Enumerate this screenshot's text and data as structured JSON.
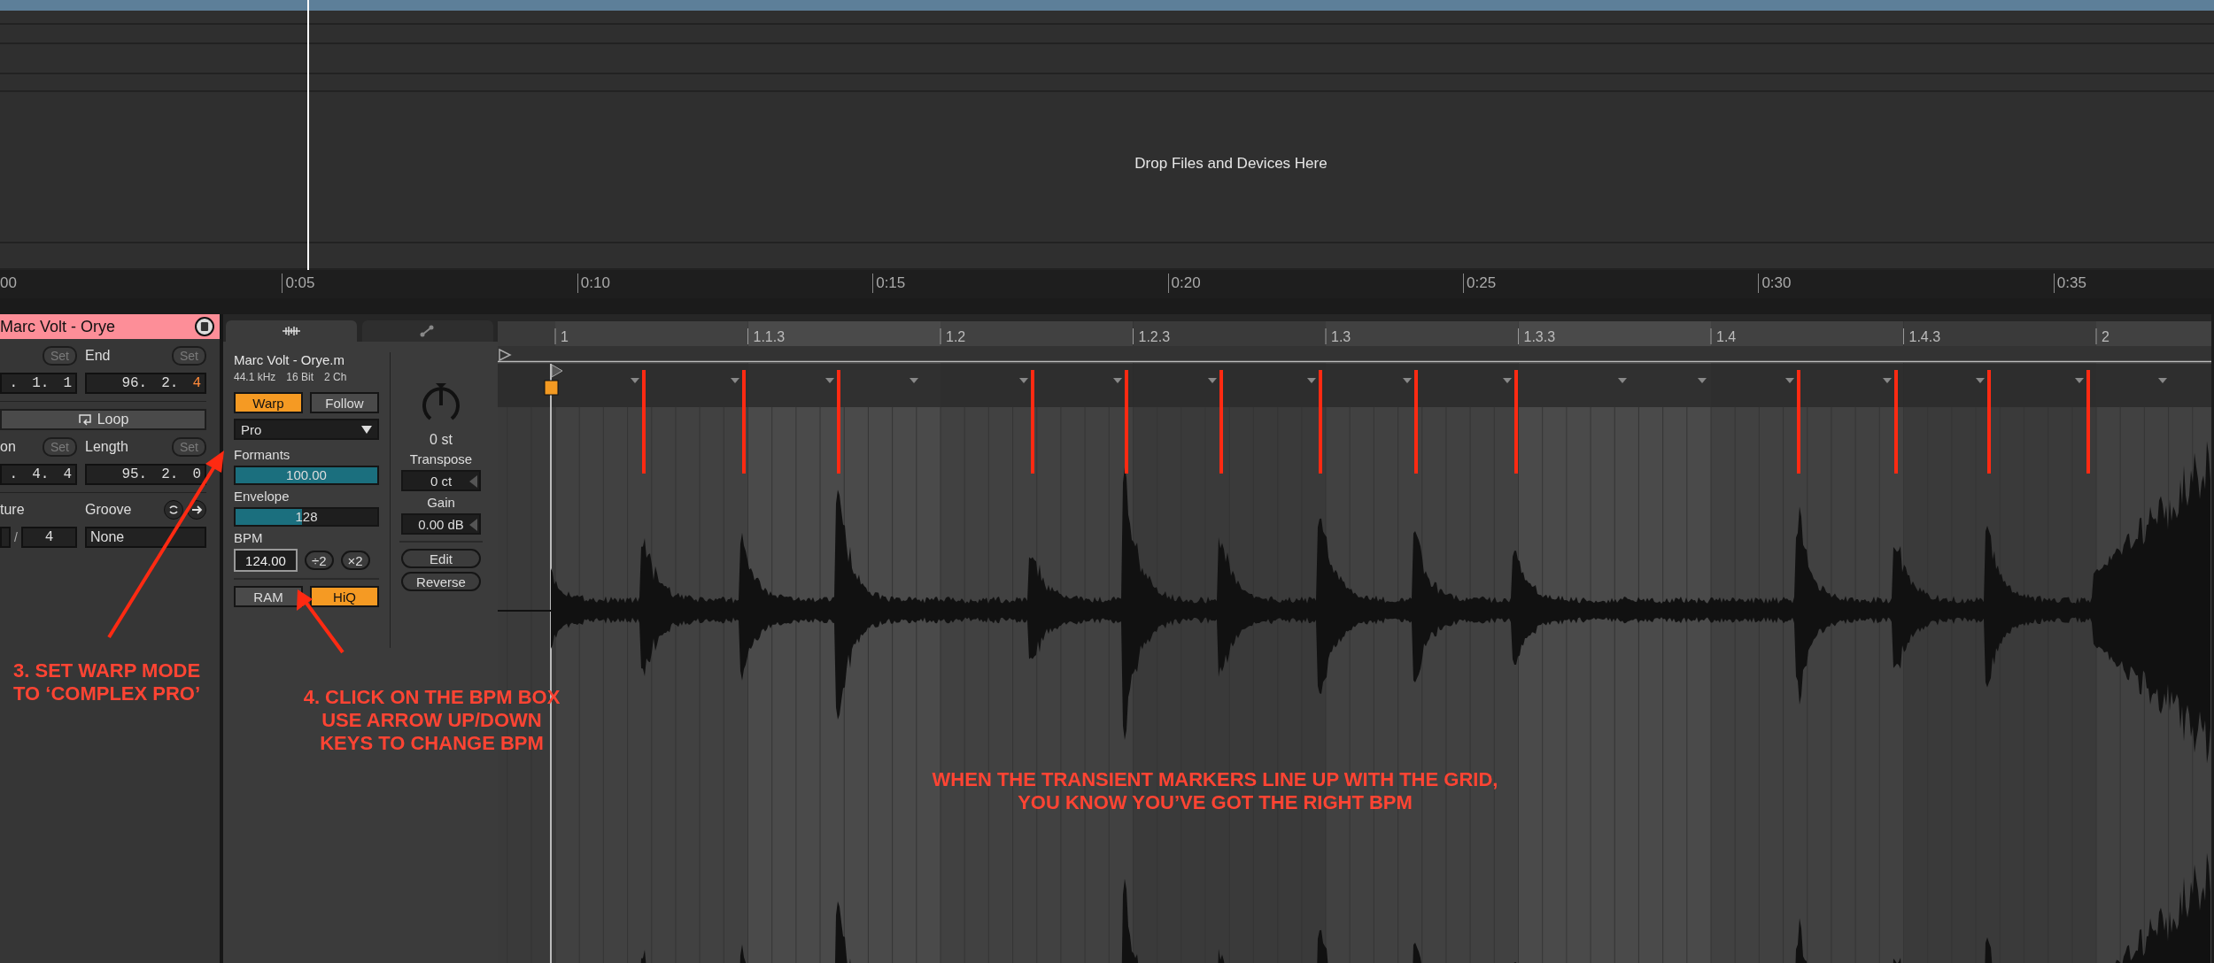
{
  "arrangement": {
    "drop_hint": "Drop Files and Devices Here",
    "time_ruler": [
      "00",
      "0:05",
      "0:10",
      "0:15",
      "0:20",
      "0:25",
      "0:30",
      "0:35"
    ]
  },
  "clip_panel": {
    "title": "Marc Volt - Orye",
    "start": {
      "set_button": {
        "label": "Set",
        "disabled": true
      },
      "value": {
        "parts": [
          ".",
          "1."
        ],
        "last": "1",
        "last_highlighted": false
      }
    },
    "end": {
      "label": "End",
      "set_button": {
        "label": "Set",
        "disabled": true
      },
      "value": {
        "parts": [
          "96.",
          "2."
        ],
        "last": "4",
        "last_highlighted": true
      }
    },
    "loop_button": {
      "label": "Loop",
      "on": false
    },
    "position": {
      "label": "on",
      "set_button": {
        "label": "Set",
        "disabled": true
      },
      "value": {
        "parts": [
          ".",
          "4."
        ],
        "last": "4",
        "last_highlighted": false
      }
    },
    "length": {
      "label": "Length",
      "set_button": {
        "label": "Set",
        "disabled": true
      },
      "value": {
        "parts": [
          "95.",
          "2."
        ],
        "last": "0",
        "last_highlighted": false
      }
    },
    "signature": {
      "label": "ture",
      "separator": "/",
      "denominator": "4"
    },
    "groove": {
      "label": "Groove",
      "value": "None"
    }
  },
  "sample_panel": {
    "tabs": [
      {
        "kind": "sample",
        "selected": true
      },
      {
        "kind": "envelope",
        "selected": false
      }
    ],
    "file_name": "Marc Volt - Orye.m",
    "info": [
      "44.1 kHz",
      "16 Bit",
      "2 Ch"
    ],
    "warp": {
      "label": "Warp",
      "on": true
    },
    "follow": {
      "label": "Follow",
      "on": false
    },
    "warp_mode": "Pro",
    "formants": {
      "label": "Formants",
      "value": "100.00",
      "level": 1.0
    },
    "envelope": {
      "label": "Envelope",
      "value": "128",
      "level": 0.47
    },
    "bpm": {
      "label": "BPM",
      "value": "124.00",
      "halve": "÷2",
      "double": "×2"
    },
    "ram": {
      "label": "RAM",
      "on": false
    },
    "hiq": {
      "label": "HiQ",
      "on": true
    },
    "transpose": {
      "value": "0 st",
      "label": "Transpose"
    },
    "detune": "0 ct",
    "gain": {
      "label": "Gain",
      "value": "0.00 dB"
    },
    "edit": "Edit",
    "reverse": "Reverse"
  },
  "clip_editor": {
    "beat_ruler": [
      "1",
      "1.1.3",
      "1.2",
      "1.2.3",
      "1.3",
      "1.3.3",
      "1.4",
      "1.4.3",
      "2"
    ]
  },
  "annotations": [
    {
      "kind": "warp_mode",
      "text": "3. SET WARP MODE\nTO ‘COMPLEX PRO’"
    },
    {
      "kind": "bpm",
      "text": "4. CLICK ON THE BPM BOX\nUSE ARROW UP/DOWN\nKEYS TO CHANGE BPM"
    },
    {
      "kind": "result",
      "text": "WHEN THE TRANSIENT MARKERS LINE UP WITH THE GRID,\nYOU KNOW YOU’VE GOT THE RIGHT BPM"
    }
  ]
}
